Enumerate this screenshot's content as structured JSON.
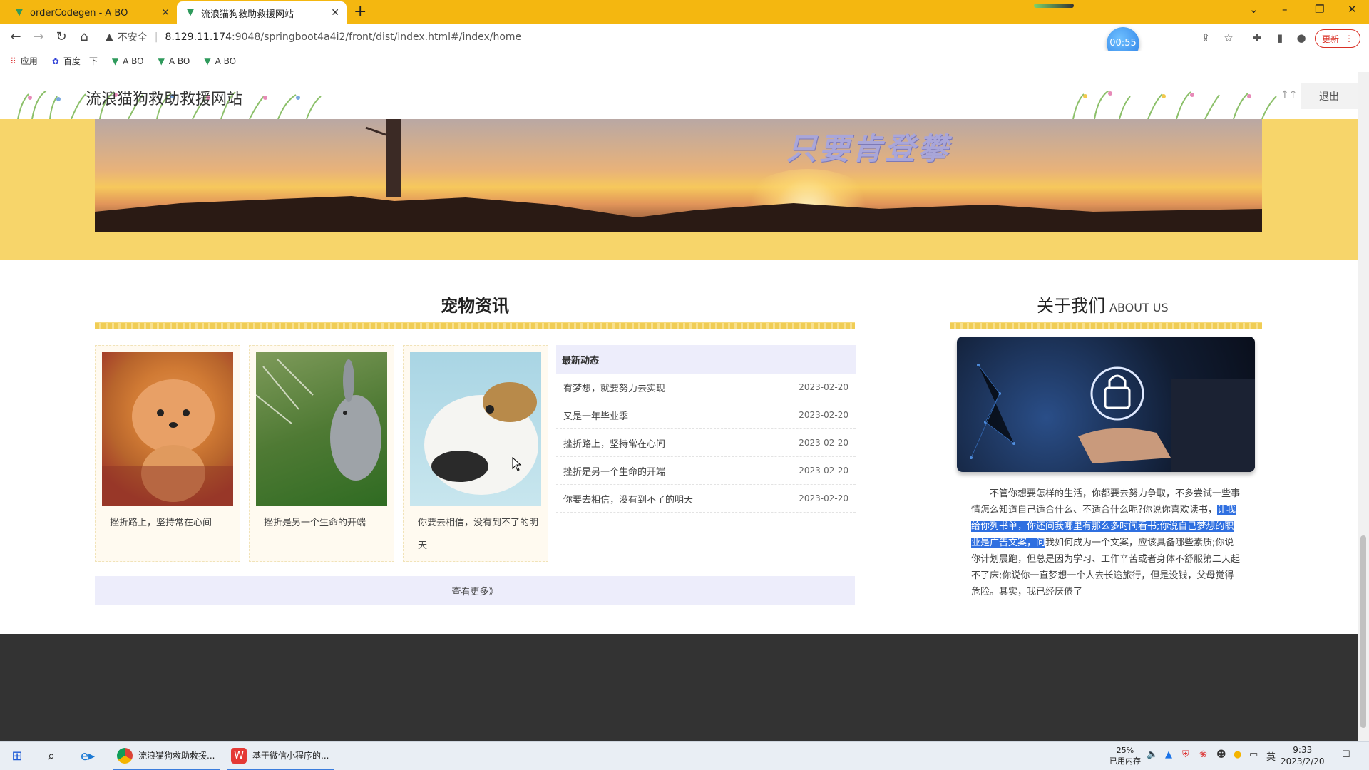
{
  "browser": {
    "tabs": [
      {
        "title": "orderCodegen - A BO",
        "active": false
      },
      {
        "title": "流浪猫狗救助救援网站",
        "active": true
      }
    ],
    "address": {
      "security_label": "不安全",
      "url_host": "8.129.11.174",
      "url_rest": ":9048/springboot4a4i2/front/dist/index.html#/index/home"
    },
    "timer": "00:55",
    "update_label": "更新",
    "bookmarks": [
      {
        "label": "应用",
        "icon": "apps-grid-icon"
      },
      {
        "label": "百度一下",
        "icon": "baidu-paw-icon"
      },
      {
        "label": "A BO",
        "icon": "vue-logo-icon"
      },
      {
        "label": "A BO",
        "icon": "vue-logo-icon"
      },
      {
        "label": "A BO",
        "icon": "vue-logo-icon"
      }
    ]
  },
  "site": {
    "title": "流浪猫狗救助救援网站",
    "logout_label": "退出",
    "banner_text": "只要肯登攀"
  },
  "news": {
    "section_title": "宠物资讯",
    "cards": [
      {
        "caption": "挫折路上，坚持常在心间"
      },
      {
        "caption": "挫折是另一个生命的开端"
      },
      {
        "caption": "你要去相信，没有到不了的明天"
      }
    ],
    "latest_header": "最新动态",
    "latest": [
      {
        "title": "有梦想，就要努力去实现",
        "date": "2023-02-20"
      },
      {
        "title": "又是一年毕业季",
        "date": "2023-02-20"
      },
      {
        "title": "挫折路上，坚持常在心间",
        "date": "2023-02-20"
      },
      {
        "title": "挫折是另一个生命的开端",
        "date": "2023-02-20"
      },
      {
        "title": "你要去相信，没有到不了的明天",
        "date": "2023-02-20"
      }
    ],
    "more_label": "查看更多》"
  },
  "about": {
    "title": "关于我们",
    "title_en": "ABOUT US",
    "text_before": "不管你想要怎样的生活，你都要去努力争取，不多尝试一些事情怎么知道自己适合什么、不适合什么呢?你说你喜欢读书，",
    "text_highlight": "让我给你列书单，你还问我哪里有那么多时间看书;你说自己梦想的职业是广告文案，问",
    "text_after": "我如何成为一个文案，应该具备哪些素质;你说你计划晨跑，但总是因为学习、工作辛苦或者身体不舒服第二天起不了床;你说你一直梦想一个人去长途旅行，但是没钱，父母觉得危险。其实，我已经厌倦了"
  },
  "taskbar": {
    "apps": [
      {
        "label": "流浪猫狗救助救援...",
        "icon": "chrome-icon"
      },
      {
        "label": "基于微信小程序的...",
        "icon": "wps-writer-icon"
      }
    ],
    "memory_percent": "25%",
    "memory_label": "已用内存",
    "ime": "英",
    "time": "9:33",
    "date": "2023/2/20"
  },
  "colors": {
    "tab_bar": "#f4b710",
    "banner_band": "#f7d56a",
    "latest_bg": "#ededfb",
    "footer": "#333333",
    "highlight": "#2f6fe0"
  }
}
